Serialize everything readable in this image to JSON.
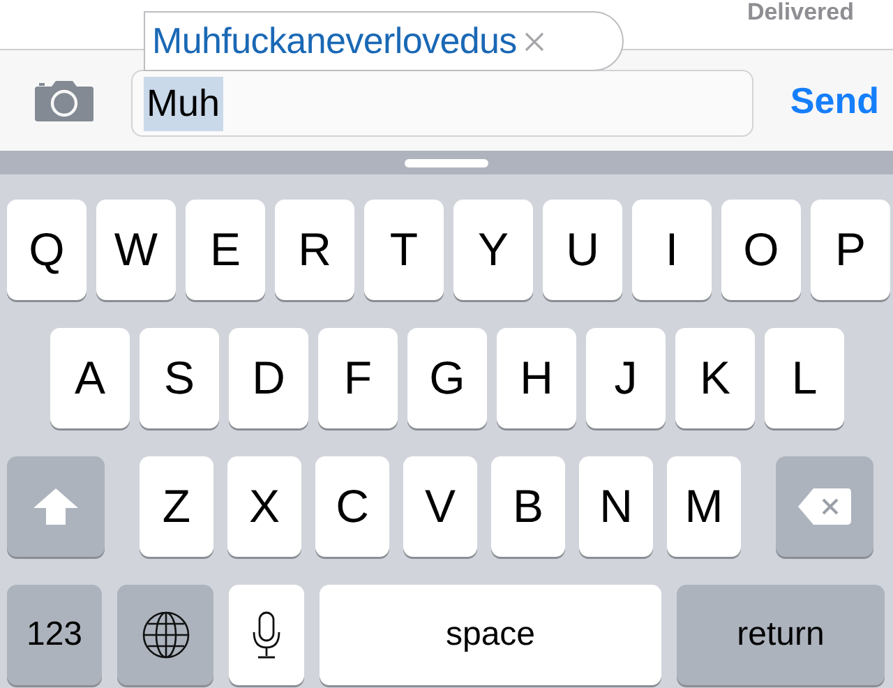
{
  "status": "Delivered",
  "suggestion": {
    "text": "Muhfuckaneverlovedus"
  },
  "composer": {
    "value": "Muh",
    "highlighted": true,
    "send": "Send"
  },
  "keyboard": {
    "letter_rows": [
      {
        "keys": [
          "Q",
          "W",
          "E",
          "R",
          "T",
          "Y",
          "U",
          "I",
          "O",
          "P"
        ]
      },
      {
        "keys": [
          "A",
          "S",
          "D",
          "F",
          "G",
          "H",
          "J",
          "K",
          "L"
        ]
      },
      {
        "keys": [
          "Z",
          "X",
          "C",
          "V",
          "B",
          "N",
          "M"
        ]
      }
    ],
    "bottom_keys": [
      {
        "kind": "numbers",
        "label": "123"
      },
      {
        "kind": "globe"
      },
      {
        "kind": "mic"
      },
      {
        "kind": "space",
        "label": "space"
      },
      {
        "kind": "return",
        "label": "return"
      }
    ]
  }
}
